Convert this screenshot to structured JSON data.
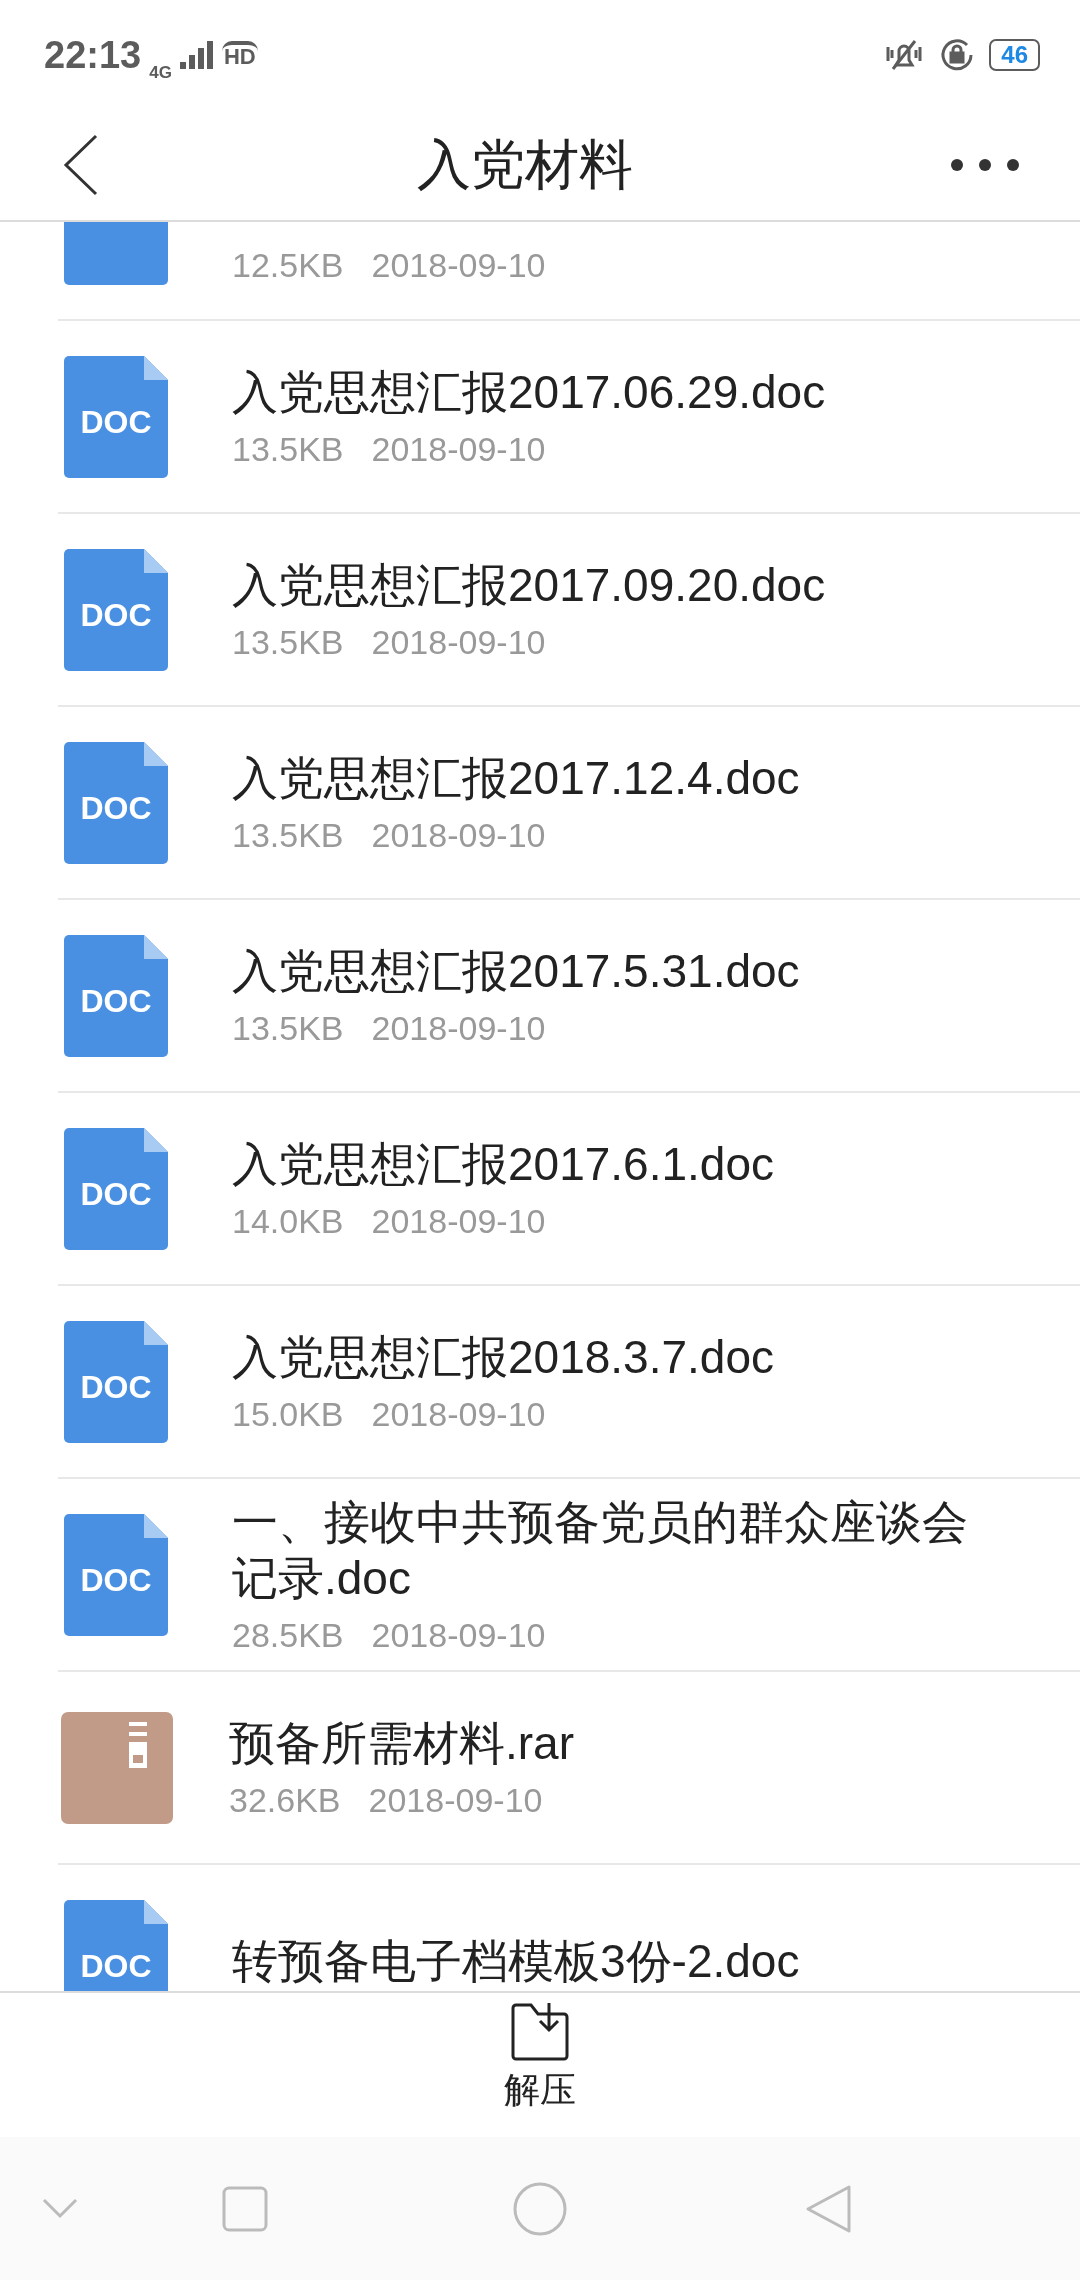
{
  "status_bar": {
    "time": "22:13",
    "network": "4G",
    "hd": "HD",
    "battery": "46"
  },
  "header": {
    "title": "入党材料"
  },
  "files": [
    {
      "kind": "doc",
      "size": "12.5KB",
      "date": "2018-09-10"
    },
    {
      "kind": "doc",
      "icon_label": "DOC",
      "name": "入党思想汇报2017.06.29.doc",
      "size": "13.5KB",
      "date": "2018-09-10"
    },
    {
      "kind": "doc",
      "icon_label": "DOC",
      "name": "入党思想汇报2017.09.20.doc",
      "size": "13.5KB",
      "date": "2018-09-10"
    },
    {
      "kind": "doc",
      "icon_label": "DOC",
      "name": "入党思想汇报2017.12.4.doc",
      "size": "13.5KB",
      "date": "2018-09-10"
    },
    {
      "kind": "doc",
      "icon_label": "DOC",
      "name": "入党思想汇报2017.5.31.doc",
      "size": "13.5KB",
      "date": "2018-09-10"
    },
    {
      "kind": "doc",
      "icon_label": "DOC",
      "name": "入党思想汇报2017.6.1.doc",
      "size": "14.0KB",
      "date": "2018-09-10"
    },
    {
      "kind": "doc",
      "icon_label": "DOC",
      "name": "入党思想汇报2018.3.7.doc",
      "size": "15.0KB",
      "date": "2018-09-10"
    },
    {
      "kind": "doc",
      "icon_label": "DOC",
      "name": "一、接收中共预备党员的群众座谈会记录.doc",
      "size": "28.5KB",
      "date": "2018-09-10"
    },
    {
      "kind": "rar",
      "name": "预备所需材料.rar",
      "size": "32.6KB",
      "date": "2018-09-10"
    },
    {
      "kind": "doc",
      "icon_label": "DOC",
      "name": "转预备电子档模板3份-2.doc"
    }
  ],
  "action_bar": {
    "label": "解压"
  }
}
